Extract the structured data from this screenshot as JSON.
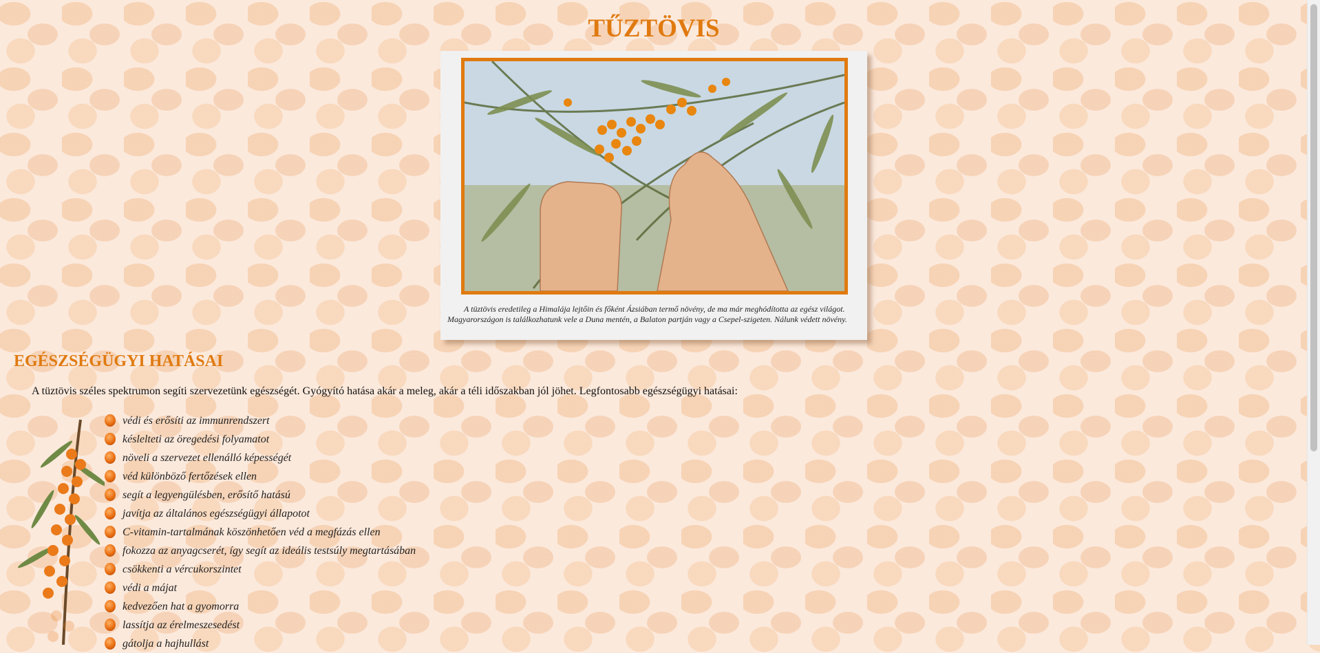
{
  "page": {
    "title": "TŰZTÖVIS"
  },
  "photo": {
    "caption": "A tüztövis eredetileg a Himalája lejtőin és főként Ázsiában termő növény, de ma már meghódította az egész világot. Magyarországon is találkozhatunk vele a Duna mentén, a Balaton partján vagy a Csepel-szigeten. Nálunk védett növény.",
    "alt": "Hands picking sea buckthorn berries"
  },
  "section": {
    "title": "EGÉSZSÉGÜGYI HATÁSAI",
    "intro": "A tüztövis széles spektrumon segíti szervezetünk egészségét. Gyógyító hatása akár a meleg, akár a téli időszakban jól jöhet. Legfontosabb egészségügyi hatásai:"
  },
  "benefits": [
    "védi és erősíti az immunrendszert",
    "késlelteti az öregedési folyamatot",
    "növeli a szervezet ellenálló képességét",
    "véd különböző fertőzések ellen",
    "segít a legyengülésben, erősítő hatású",
    "javítja az általános egészségügyi állapotot",
    "C-vitamin-tartalmának köszönhetően véd a megfázás ellen",
    "fokozza az anyagcserét, így segít az ideális testsúly megtartásában",
    "csökkenti a vércukorszintet",
    "védi a májat",
    "kedvezően hat a gyomorra",
    "lassítja az érelmeszesedést",
    "gátolja a hajhullást"
  ],
  "colors": {
    "accent": "#e07a10",
    "background": "#fbe9dc"
  },
  "icons": {
    "bullet": "orange-berry-icon",
    "branch": "sea-buckthorn-branch-icon"
  }
}
